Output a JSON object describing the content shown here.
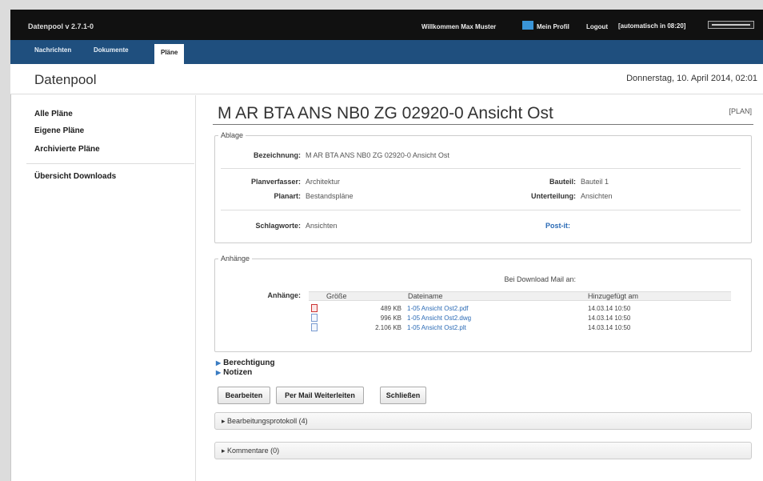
{
  "topbar": {
    "app_version": "Datenpool v 2.7.1-0",
    "welcome": "Willkommen Max Muster",
    "profile": "Mein Profil",
    "logout": "Logout",
    "auto_logout": "[automatisch in 08:20]"
  },
  "nav": {
    "tabs": [
      "Nachrichten",
      "Dokumente",
      "Pläne"
    ],
    "active": "Pläne"
  },
  "header": {
    "brand": "Datenpool",
    "date": "Donnerstag, 10. April 2014, 02:01"
  },
  "sidebar": {
    "items": [
      "Alle Pläne",
      "Eigene Pläne",
      "Archivierte Pläne",
      "Übersicht Downloads"
    ]
  },
  "main": {
    "title": "M AR BTA ANS NB0 ZG 02920-0 Ansicht Ost",
    "tag": "[PLAN]",
    "ablage": {
      "legend": "Ablage",
      "bezeichnung_label": "Bezeichnung:",
      "bezeichnung": "M AR BTA ANS NB0 ZG 02920-0 Ansicht Ost",
      "planverfasser_label": "Planverfasser:",
      "planverfasser": "Architektur",
      "planart_label": "Planart:",
      "planart": "Bestandspläne",
      "bauteil_label": "Bauteil:",
      "bauteil": "Bauteil 1",
      "unterteilung_label": "Unterteilung:",
      "unterteilung": "Ansichten",
      "schlagworte_label": "Schlagworte:",
      "schlagworte": "Ansichten",
      "postit": "Post-it:"
    },
    "anhaenge": {
      "legend": "Anhänge",
      "mail_label": "Bei Download Mail an:",
      "label": "Anhänge:",
      "columns": [
        "Größe",
        "Dateiname",
        "Hinzugefügt am"
      ],
      "files": [
        {
          "size": "489 KB",
          "name": "1-05 Ansicht Ost2.pdf",
          "date": "14.03.14 10:50",
          "icon": "pdf-icon"
        },
        {
          "size": "996 KB",
          "name": "1-05 Ansicht Ost2.dwg",
          "date": "14.03.14 10:50",
          "icon": "file-icon"
        },
        {
          "size": "2.106 KB",
          "name": "1-05 Ansicht Ost2.plt",
          "date": "14.03.14 10:50",
          "icon": "file-icon"
        }
      ]
    },
    "toggles": [
      "Berechtigung",
      "Notizen"
    ],
    "buttons": [
      "Bearbeiten",
      "Per Mail Weiterleiten",
      "Schließen"
    ],
    "accordions": [
      "Bearbeitungsprotokoll (4)",
      "Kommentare (0)"
    ]
  }
}
